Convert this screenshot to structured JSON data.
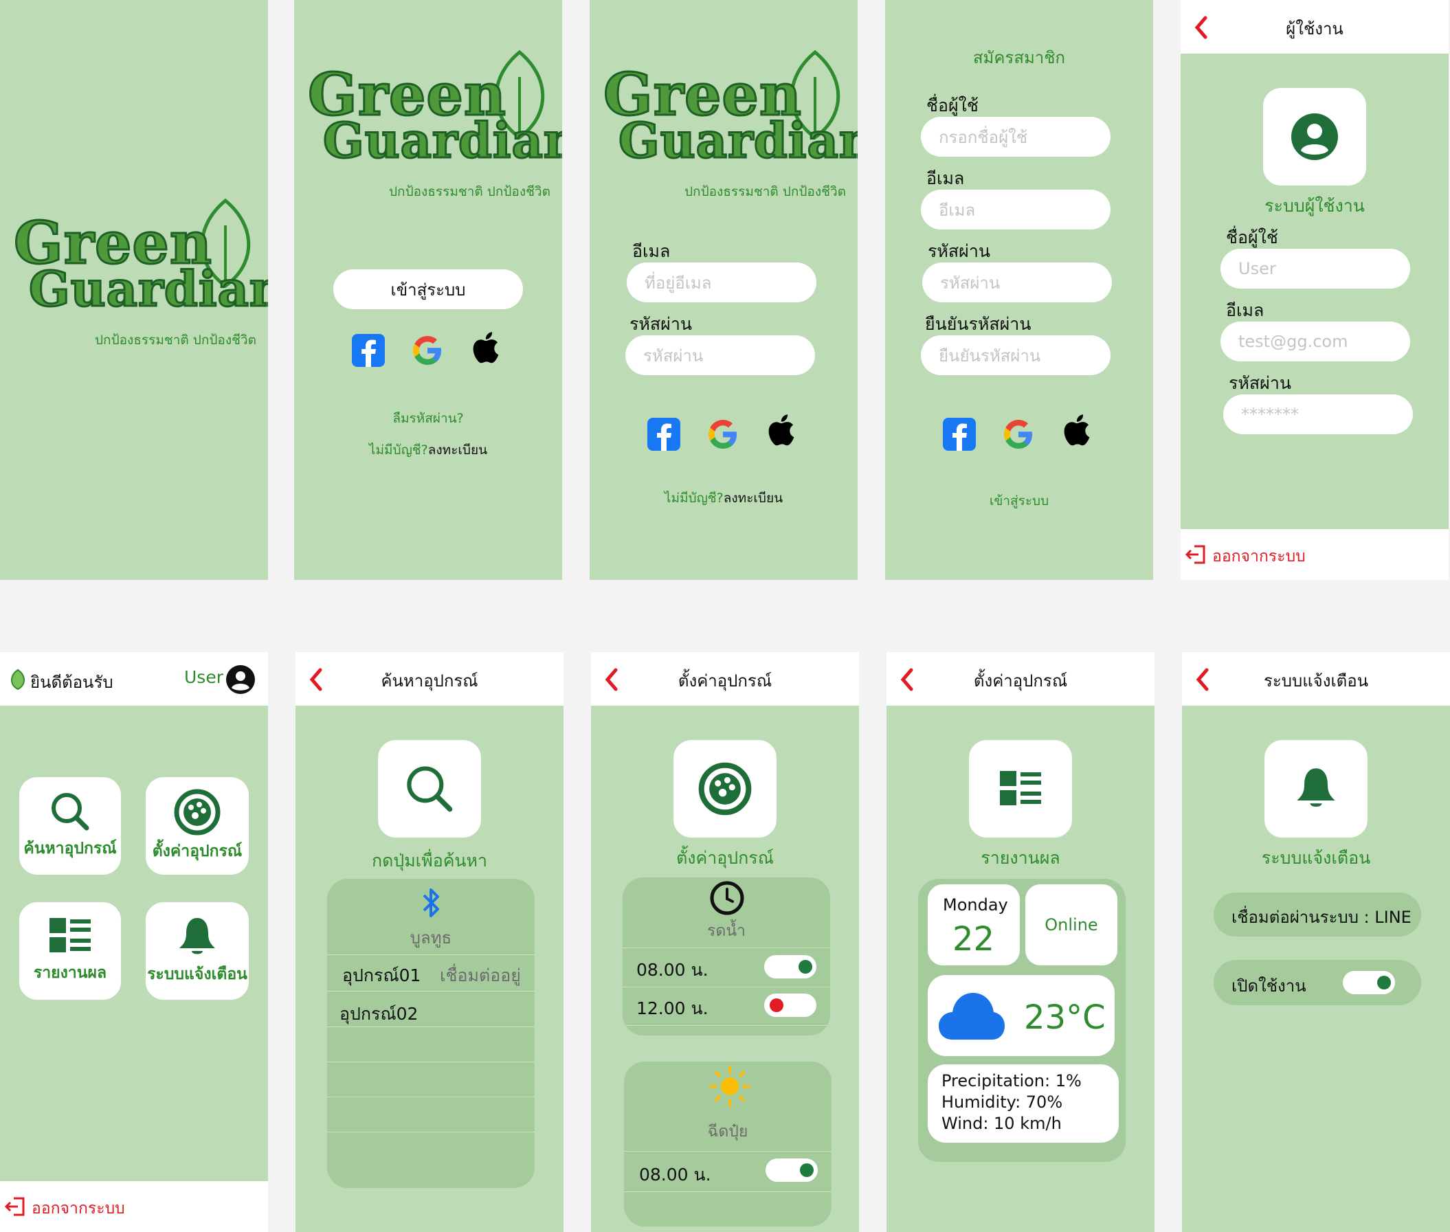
{
  "brand": {
    "word1": "Green",
    "word2": "Guardian",
    "tagline": "ปกป้องธรรมชาติ ปกป้องชีวิต"
  },
  "colors": {
    "background": "#bddbb5",
    "accent_green": "#2e8b2e",
    "dark_green": "#1f6e3a",
    "danger_red": "#e01b24",
    "panel": "#a5cb9c"
  },
  "welcome_screen": {
    "login_button": "เข้าสู่ระบบ",
    "forgot": "ลืมรหัสผ่าน?",
    "no_account": "ไม่มีบัญชี?",
    "register": "ลงทะเบียน",
    "social": [
      "facebook-icon",
      "google-icon",
      "apple-icon"
    ]
  },
  "login_screen": {
    "email_label": "อีเมล",
    "email_placeholder": "ที่อยู่อีเมล",
    "password_label": "รหัสผ่าน",
    "password_placeholder": "รหัสผ่าน",
    "no_account": "ไม่มีบัญชี?",
    "register": "ลงทะเบียน"
  },
  "register_screen": {
    "title": "สมัครสมาชิก",
    "username_label": "ชื่อผู้ใช้",
    "username_placeholder": "กรอกชื่อผู้ใช้",
    "email_label": "อีเมล",
    "email_placeholder": "อีเมล",
    "password_label": "รหัสผ่าน",
    "password_placeholder": "รหัสผ่าน",
    "confirm_label": "ยืนยันรหัสผ่าน",
    "confirm_placeholder": "ยืนยันรหัสผ่าน",
    "login_link": "เข้าสู่ระบบ"
  },
  "profile_screen": {
    "title": "ผู้ใช้งาน",
    "caption": "ระบบผู้ใช้งาน",
    "username_label": "ชื่อผู้ใช้",
    "username_value": "User",
    "email_label": "อีเมล",
    "email_value": "test@gg.com",
    "password_label": "รหัสผ่าน",
    "password_value": "*******",
    "logout": "ออกจากระบบ"
  },
  "home_screen": {
    "welcome": "ยินดีต้อนรับ",
    "user": "User",
    "menu": [
      {
        "label": "ค้นหาอุปกรณ์",
        "icon": "search-icon"
      },
      {
        "label": "ตั้งค่าอุปกรณ์",
        "icon": "settings-icon"
      },
      {
        "label": "รายงานผล",
        "icon": "report-icon"
      },
      {
        "label": "ระบบแจ้งเตือน",
        "icon": "bell-icon"
      }
    ],
    "logout": "ออกจากระบบ"
  },
  "search_screen": {
    "title": "ค้นหาอุปกรณ์",
    "caption": "กดปุ่มเพื่อค้นหา",
    "bluetooth": "บูลทูธ",
    "devices": [
      {
        "name": "อุปกรณ์01",
        "status": "เชื่อมต่ออยู่"
      },
      {
        "name": "อุปกรณ์02",
        "status": ""
      }
    ]
  },
  "settings_screen": {
    "title": "ตั้งค่าอุปกรณ์",
    "caption": "ตั้งค่าอุปกรณ์",
    "water": {
      "label": "รดน้ำ",
      "schedules": [
        {
          "time": "08.00 น.",
          "on": true
        },
        {
          "time": "12.00 น.",
          "on": false
        }
      ]
    },
    "fertilize": {
      "label": "ฉีดปุ๋ย",
      "schedules": [
        {
          "time": "08.00 น.",
          "on": true
        }
      ]
    }
  },
  "report_screen": {
    "title": "ตั้งค่าอุปกรณ์",
    "caption": "รายงานผล",
    "day": "Monday",
    "date": "22",
    "status": "Online",
    "temperature": "23°C",
    "precipitation": "Precipitation: 1%",
    "humidity": "Humidity: 70%",
    "wind": "Wind: 10 km/h"
  },
  "alert_screen": {
    "title": "ระบบแจ้งเตือน",
    "caption": "ระบบแจ้งเตือน",
    "line": "เชื่อมต่อผ่านระบบ : LINE",
    "enable": "เปิดใช้งาน",
    "enabled": true
  }
}
